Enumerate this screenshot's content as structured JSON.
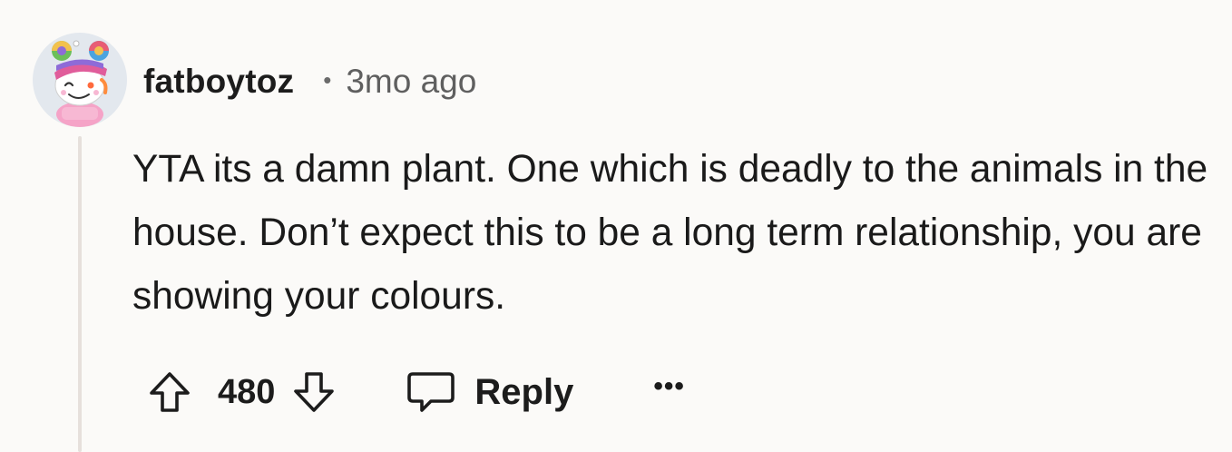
{
  "comment": {
    "username": "fatboytoz",
    "separator": "•",
    "timestamp": "3mo ago",
    "body": "YTA its a damn plant. One which is deadly to the animals in the house. Don’t expect this to be a long term relationship, you are showing your colours.",
    "score": "480",
    "reply_label": "Reply",
    "more_label": "•••",
    "avatar": "snoo-avatar-rainbow-hair"
  },
  "icons": {
    "upvote": "arrow-up-icon",
    "downvote": "arrow-down-icon",
    "reply": "speech-bubble-icon",
    "more": "ellipsis-icon"
  },
  "colors": {
    "background": "#fbfaf8",
    "text": "#1c1c1c",
    "muted": "#5f5f5f",
    "thread_line": "#e6e0dc"
  }
}
